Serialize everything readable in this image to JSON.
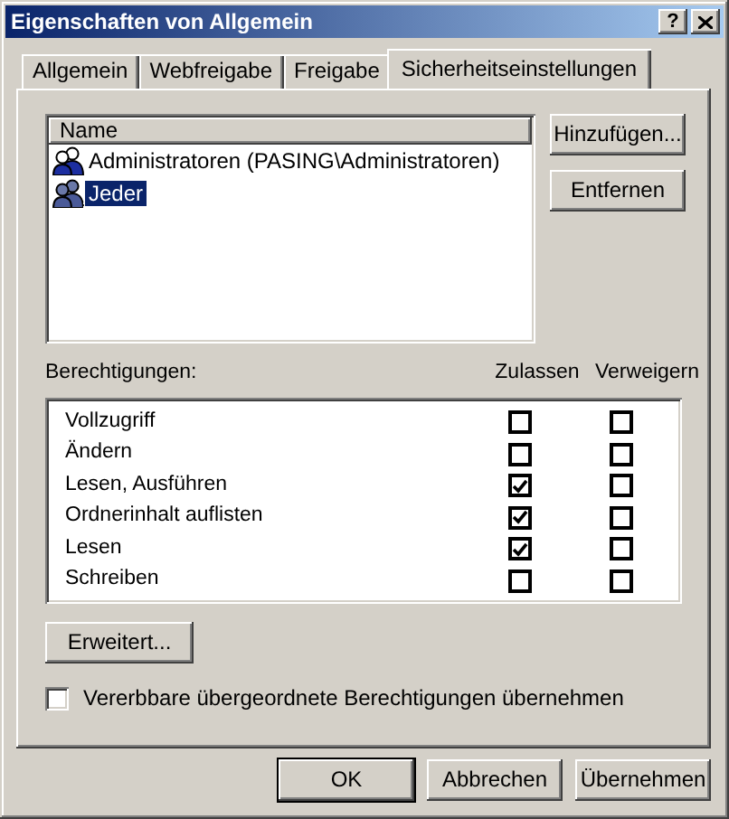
{
  "window": {
    "title": "Eigenschaften von Allgemein",
    "help": "?"
  },
  "tabs": [
    {
      "label": "Allgemein",
      "selected": false
    },
    {
      "label": "Webfreigabe",
      "selected": false
    },
    {
      "label": "Freigabe",
      "selected": false
    },
    {
      "label": "Sicherheitseinstellungen",
      "selected": true
    }
  ],
  "users": {
    "column": "Name",
    "rows": [
      {
        "name": "Administratoren (PASING\\Administratoren)",
        "selected": false
      },
      {
        "name": "Jeder",
        "selected": true
      }
    ]
  },
  "user_buttons": [
    "Hinzufügen...",
    "Entfernen"
  ],
  "permissions": {
    "label": "Berechtigungen:",
    "columns": [
      "Zulassen",
      "Verweigern"
    ],
    "rows": [
      {
        "name": "Vollzugriff",
        "allow": false,
        "deny": false
      },
      {
        "name": "Ändern",
        "allow": false,
        "deny": false
      },
      {
        "name": "Lesen, Ausführen",
        "allow": true,
        "deny": false
      },
      {
        "name": "Ordnerinhalt auflisten",
        "allow": true,
        "deny": false
      },
      {
        "name": "Lesen",
        "allow": true,
        "deny": false
      },
      {
        "name": "Schreiben",
        "allow": false,
        "deny": false
      }
    ]
  },
  "advanced_button": "Erweitert...",
  "inherit": {
    "label": "Vererbbare übergeordnete Berechtigungen übernehmen",
    "checked": false
  },
  "buttons": [
    {
      "label": "OK",
      "default": true
    },
    {
      "label": "Abbrechen",
      "default": false
    },
    {
      "label": "Übernehmen",
      "default": false
    }
  ]
}
